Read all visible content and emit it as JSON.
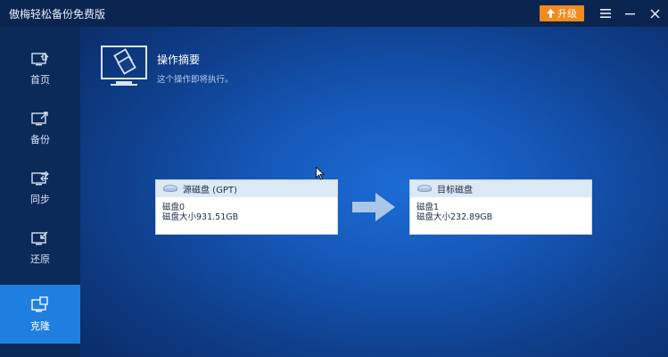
{
  "app": {
    "title": "傲梅轻松备份免费版",
    "upgrade_label": "升级"
  },
  "sidebar": {
    "items": [
      {
        "label": "首页",
        "icon": "home-icon"
      },
      {
        "label": "备份",
        "icon": "backup-icon"
      },
      {
        "label": "同步",
        "icon": "sync-icon"
      },
      {
        "label": "还原",
        "icon": "restore-icon"
      },
      {
        "label": "克隆",
        "icon": "clone-icon",
        "active": true
      }
    ]
  },
  "summary": {
    "title": "操作摘要",
    "subtitle": "这个操作即将执行。"
  },
  "source_disk": {
    "header": "源磁盘 (GPT)",
    "name": "磁盘0",
    "size": "磁盘大小931.51GB"
  },
  "target_disk": {
    "header": "目标磁盘",
    "name": "磁盘1",
    "size": "磁盘大小232.89GB"
  },
  "colors": {
    "accent": "#1f7fe0",
    "upgrade": "#f28a1c",
    "sidebar_bg": "#0b2a58"
  }
}
